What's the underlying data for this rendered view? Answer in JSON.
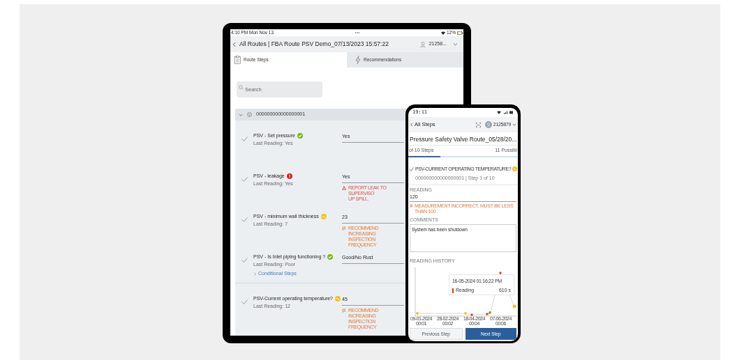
{
  "tablet": {
    "status_bar": {
      "time": "4:10 PM  Mon Nov 13",
      "dots": "•••",
      "battery": "12%"
    },
    "header": {
      "title": "All Routes | FBA Route PSV Demo_07/13/2023 15:57:22",
      "user": "21258..."
    },
    "tabs": [
      {
        "label": "Route Steps",
        "kind": "steps",
        "selected": true
      },
      {
        "label": "Recommendations",
        "kind": "recommendations",
        "selected": false
      }
    ],
    "search": {
      "placeholder": "Search"
    },
    "group": {
      "label": "000000000000000001",
      "expanded": true
    },
    "steps": [
      {
        "title": "PSV - Set pressure",
        "kind": "ok",
        "last_reading": "Last Reading: Yes",
        "value": "Yes"
      },
      {
        "title": "PSV - leakage",
        "kind": "alert",
        "last_reading": "Last Reading: Yes",
        "value": "Yes",
        "message": {
          "kind": "warning",
          "text": "REPORT LEAK TO SUPERVISO\nUP SPILL."
        }
      },
      {
        "title": "PSV - minimum wall thickness",
        "kind": "trend",
        "last_reading": "Last Reading: 7",
        "value": "23",
        "message": {
          "kind": "flag",
          "text": "RECOMMEND INCREASING\nINSPECTION FREQUENCY"
        }
      },
      {
        "title": "PSV - Is Inlet piping functioning ?",
        "kind": "ok",
        "last_reading": "Last Reading: Poor",
        "value": "Good/No Rust",
        "link": "Conditional Steps"
      },
      {
        "title": "PSV-Current operating temperature?",
        "kind": "trend",
        "last_reading": "Last Reading: 12",
        "value": "45",
        "message": {
          "kind": "flag",
          "text": "RECOMMEND INCREASING\nINSPECTION FREQUENCY"
        }
      }
    ]
  },
  "phone": {
    "status_bar": {
      "time": "19:11"
    },
    "header": {
      "back": "All Steps",
      "user": "2125879"
    },
    "title": "Pressure Safety Valve Route_05/28/20...",
    "progress": {
      "left": "of 10 Steps",
      "right": "11 Possibl",
      "level": 0.29
    },
    "step": {
      "title": "PSV-CURRENT OPERATING TEMPERATURE?",
      "kind": "trend",
      "path": "000000000000000001 | Step 1 of 10"
    },
    "reading": {
      "label": "READING",
      "value": "120",
      "message": {
        "kind": "flag",
        "text": "MEASUREMENT INCORRECT, MUST BE LESS THAN 100"
      }
    },
    "comments": {
      "label": "COMMENTS",
      "value": "System has been shutdown"
    },
    "history": {
      "label": "READING HISTORY",
      "x_labels": [
        "09-01-2024\n00:01",
        "28-02-2024\n00:02",
        "18-04-2024\n00:04",
        "07-06-2024\n00:06"
      ],
      "tooltip": {
        "time": "16-05-2024 01:16:22 PM",
        "series": "Reading",
        "value": "610 s"
      }
    },
    "buttons": [
      {
        "label": "Previous Step",
        "kind": "secondary"
      },
      {
        "label": "Next Step",
        "kind": "primary"
      }
    ]
  }
}
